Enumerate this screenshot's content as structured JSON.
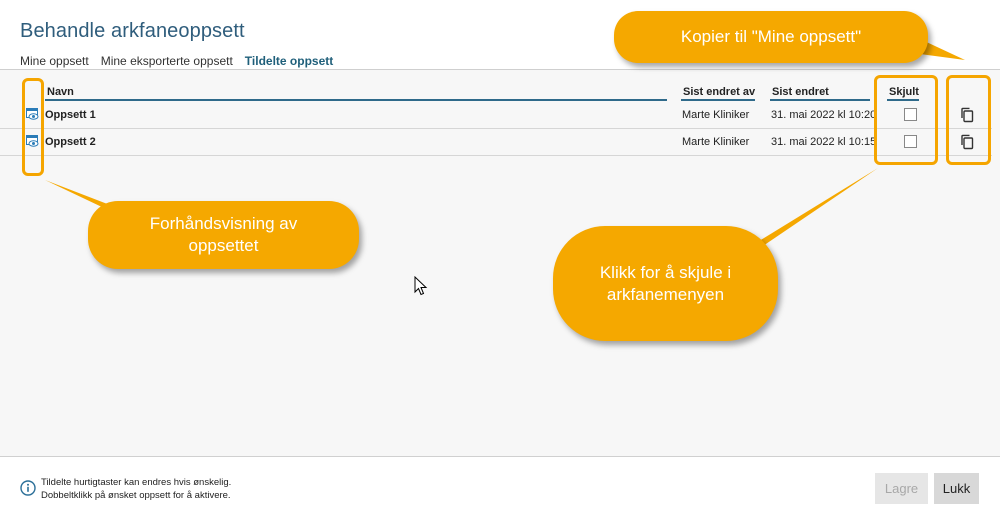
{
  "title": "Behandle arkfaneoppsett",
  "tabs": [
    {
      "label": "Mine oppsett"
    },
    {
      "label": "Mine eksporterte oppsett"
    },
    {
      "label": "Tildelte oppsett"
    }
  ],
  "active_tab": "Tildelte oppsett",
  "table": {
    "columns": {
      "name": "Navn",
      "changed_by": "Sist endret av",
      "changed": "Sist endret",
      "hidden": "Skjult"
    },
    "rows": [
      {
        "name": "Oppsett 1",
        "changed_by": "Marte Kliniker",
        "changed": "31. mai 2022 kl 10:20",
        "hidden": false
      },
      {
        "name": "Oppsett 2",
        "changed_by": "Marte Kliniker",
        "changed": "31. mai 2022 kl 10:15",
        "hidden": false
      }
    ]
  },
  "footer": {
    "info_line1": "Tildelte hurtigtaster kan endres hvis ønskelig.",
    "info_line2": "Dobbeltklikk på ønsket oppsett for å aktivere.",
    "save_label": "Lagre",
    "close_label": "Lukk"
  },
  "callouts": {
    "copy": "Kopier til \"Mine oppsett\"",
    "preview": "Forhåndsvisning av oppsettet",
    "hide": "Klikk for å skjule i arkfanemenyen"
  },
  "colors": {
    "accent": "#1f5f7a",
    "callout": "#f5a800"
  },
  "icons": {
    "preview": "preview-icon",
    "copy": "copy-icon",
    "info": "info-icon",
    "cursor": "mouse-cursor"
  }
}
